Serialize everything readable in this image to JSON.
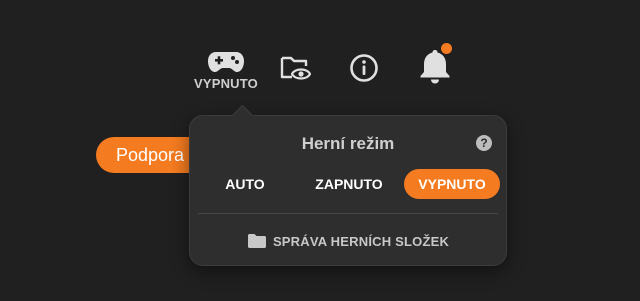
{
  "toolbar": {
    "game_mode_label": "VYPNUTO",
    "icons": [
      "gamepad-icon",
      "folder-eye-icon",
      "info-icon",
      "bell-icon"
    ],
    "notification_dot_color": "#f47b20"
  },
  "support_button": {
    "label": "Podpora"
  },
  "game_mode_popup": {
    "title": "Herní režim",
    "help_symbol": "?",
    "modes": [
      {
        "label": "AUTO",
        "selected": false
      },
      {
        "label": "ZAPNUTO",
        "selected": false
      },
      {
        "label": "VYPNUTO",
        "selected": true
      }
    ],
    "manage_folders_label": "SPRÁVA HERNÍCH SLOŽEK",
    "accent_color": "#f47b20"
  }
}
